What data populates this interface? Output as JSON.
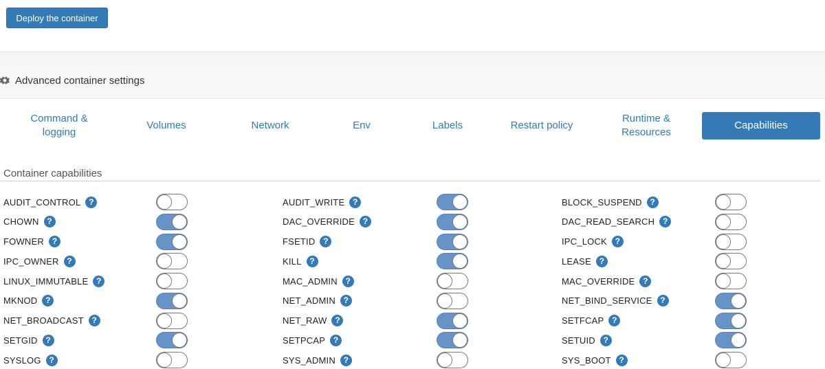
{
  "deploy_button": "Deploy the container",
  "advanced_settings_title": "Advanced container settings",
  "tabs": [
    {
      "label": "Command &\nlogging",
      "active": false
    },
    {
      "label": "Volumes",
      "active": false
    },
    {
      "label": "Network",
      "active": false
    },
    {
      "label": "Env",
      "active": false
    },
    {
      "label": "Labels",
      "active": false
    },
    {
      "label": "Restart policy",
      "active": false
    },
    {
      "label": "Runtime &\nResources",
      "active": false
    },
    {
      "label": "Capabilities",
      "active": true
    }
  ],
  "section_title": "Container capabilities",
  "help_glyph": "?",
  "accent_color": "#337ab7",
  "toggle_on_color": "#6893c8",
  "capabilities": [
    [
      {
        "name": "AUDIT_CONTROL",
        "enabled": false
      },
      {
        "name": "CHOWN",
        "enabled": true
      },
      {
        "name": "FOWNER",
        "enabled": true
      },
      {
        "name": "IPC_OWNER",
        "enabled": false
      },
      {
        "name": "LINUX_IMMUTABLE",
        "enabled": false
      },
      {
        "name": "MKNOD",
        "enabled": true
      },
      {
        "name": "NET_BROADCAST",
        "enabled": false
      },
      {
        "name": "SETGID",
        "enabled": true
      },
      {
        "name": "SYSLOG",
        "enabled": false
      }
    ],
    [
      {
        "name": "AUDIT_WRITE",
        "enabled": true
      },
      {
        "name": "DAC_OVERRIDE",
        "enabled": true
      },
      {
        "name": "FSETID",
        "enabled": true
      },
      {
        "name": "KILL",
        "enabled": true
      },
      {
        "name": "MAC_ADMIN",
        "enabled": false
      },
      {
        "name": "NET_ADMIN",
        "enabled": false
      },
      {
        "name": "NET_RAW",
        "enabled": true
      },
      {
        "name": "SETPCAP",
        "enabled": true
      },
      {
        "name": "SYS_ADMIN",
        "enabled": false
      }
    ],
    [
      {
        "name": "BLOCK_SUSPEND",
        "enabled": false
      },
      {
        "name": "DAC_READ_SEARCH",
        "enabled": false
      },
      {
        "name": "IPC_LOCK",
        "enabled": false
      },
      {
        "name": "LEASE",
        "enabled": false
      },
      {
        "name": "MAC_OVERRIDE",
        "enabled": false
      },
      {
        "name": "NET_BIND_SERVICE",
        "enabled": true
      },
      {
        "name": "SETFCAP",
        "enabled": true
      },
      {
        "name": "SETUID",
        "enabled": true
      },
      {
        "name": "SYS_BOOT",
        "enabled": false
      }
    ]
  ]
}
